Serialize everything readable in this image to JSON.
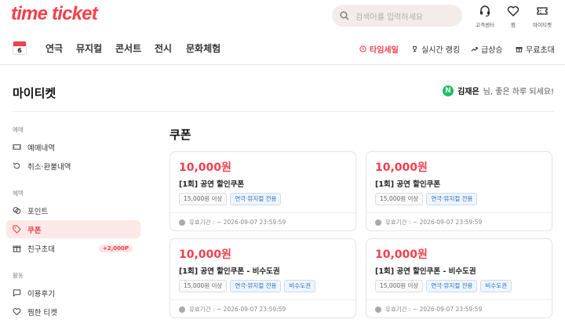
{
  "header": {
    "logo": "time ticket",
    "search_placeholder": "검색어를 입력하세요",
    "icons": [
      {
        "icon": "headset-icon",
        "label": "고객센터"
      },
      {
        "icon": "heart-icon",
        "label": "찜"
      },
      {
        "icon": "ticket-icon",
        "label": "마이티켓"
      }
    ]
  },
  "nav": {
    "calendar_day": "6",
    "categories": [
      "연극",
      "뮤지컬",
      "콘서트",
      "전시",
      "문화체험"
    ],
    "right": [
      "타임세일",
      "실시간 랭킹",
      "급상승",
      "무료초대"
    ]
  },
  "page": {
    "title": "마이티켓",
    "greeting_badge": "N",
    "greeting_name": "김재은",
    "greeting_suffix": "님, 좋은 하루 되세요!"
  },
  "sidebar": {
    "sections": [
      {
        "label": "예매",
        "items": [
          {
            "label": "예매내역",
            "icon": "ticket-icon"
          },
          {
            "label": "취소·환불내역",
            "icon": "refresh-icon"
          }
        ]
      },
      {
        "label": "혜택",
        "items": [
          {
            "label": "포인트",
            "icon": "coins-icon"
          },
          {
            "label": "쿠폰",
            "icon": "tag-icon"
          },
          {
            "label": "친구초대",
            "icon": "gift-icon",
            "badge": "+2,000P"
          }
        ]
      },
      {
        "label": "활동",
        "items": [
          {
            "label": "이용후기",
            "icon": "chat-icon"
          },
          {
            "label": "찜한 티켓",
            "icon": "heart-icon"
          }
        ]
      }
    ],
    "active": "쿠폰"
  },
  "content": {
    "title": "쿠폰",
    "coupons": [
      {
        "amount": "10,000원",
        "name": "[1회] 공연 할인쿠폰",
        "tags": [
          "15,000원 이상",
          "연극·뮤지컬 전용"
        ],
        "expiry": "유효기간 : ~ 2026-09-07 23:59:59"
      },
      {
        "amount": "10,000원",
        "name": "[1회] 공연 할인쿠폰",
        "tags": [
          "15,000원 이상",
          "연극·뮤지컬 전용"
        ],
        "expiry": "유효기간 : ~ 2026-09-07 23:59:59"
      },
      {
        "amount": "10,000원",
        "name": "[1회] 공연 할인쿠폰 - 비수도권",
        "tags": [
          "15,000원 이상",
          "연극·뮤지컬 전용",
          "비수도권"
        ],
        "expiry": "유효기간 : ~ 2026-09-07 23:59:59"
      },
      {
        "amount": "10,000원",
        "name": "[1회] 공연 할인쿠폰 - 비수도권",
        "tags": [
          "15,000원 이상",
          "연극·뮤지컬 전용",
          "비수도권"
        ],
        "expiry": "유효기간 : ~ 2026-09-07 23:59:59"
      }
    ]
  },
  "colors": {
    "brand": "#f0414d",
    "active_bg": "#fde8e8",
    "tag_blue": "#2f6fb8"
  }
}
